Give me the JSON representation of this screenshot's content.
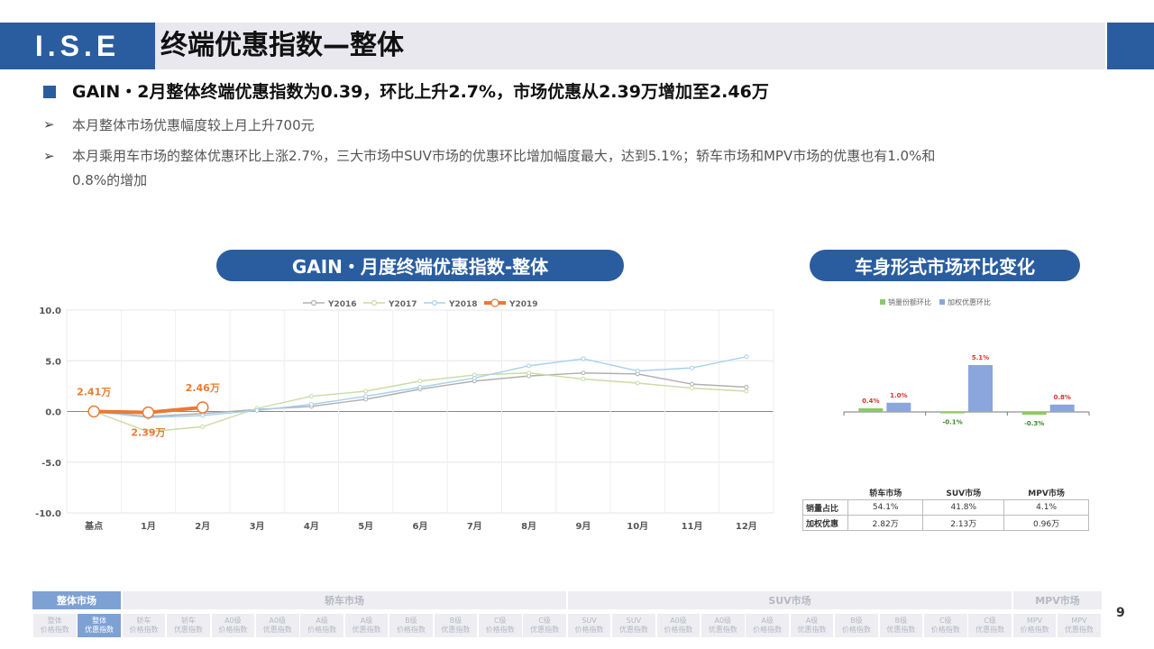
{
  "header": {
    "logo": "I.S.E",
    "title": "终端优惠指数—整体"
  },
  "headline": "GAIN・2月整体终端优惠指数为0.39，环比上升2.7%，市场优惠从2.39万增加至2.46万",
  "bullets": [
    {
      "arrow": "➢",
      "text": "本月整体市场优惠幅度较上月上升700元"
    },
    {
      "arrow": "➢",
      "text": "本月乘用车市场的整体优惠环比上涨2.7%，三大市场中SUV市场的优惠环比增加幅度最大，达到5.1%；轿车市场和MPV市场的优惠也有1.0%和",
      "cont": "0.8%的增加"
    }
  ],
  "left_section_title": "GAIN・月度终端优惠指数-整体",
  "right_section_title": "车身形式市场环比变化",
  "colors": {
    "brand": "#2a5d9f",
    "y2016": "#b0b0b0",
    "y2017": "#c8dca6",
    "y2018": "#a8d0ec",
    "y2019": "#ea7a34",
    "bar_green": "#8dc868",
    "bar_blue": "#8aa6dc"
  },
  "chart_data": [
    {
      "type": "line",
      "categories": [
        "基点",
        "1月",
        "2月",
        "3月",
        "4月",
        "5月",
        "6月",
        "7月",
        "8月",
        "9月",
        "10月",
        "11月",
        "12月"
      ],
      "ylim": [
        -10,
        10
      ],
      "yticks": [
        "10.0",
        "5.0",
        "0.0",
        "-5.0",
        "-10.0"
      ],
      "yticks_values": [
        10,
        5,
        0,
        -5,
        -10
      ],
      "grid": true,
      "legend": "top-center",
      "series": [
        {
          "name": "Y2016",
          "values": [
            0,
            -0.5,
            -0.2,
            0.2,
            0.5,
            1.2,
            2.2,
            3.0,
            3.5,
            3.8,
            3.7,
            2.7,
            2.4
          ]
        },
        {
          "name": "Y2017",
          "values": [
            0,
            -2.0,
            -1.5,
            0.3,
            1.5,
            2.0,
            3.0,
            3.6,
            3.8,
            3.2,
            2.8,
            2.3,
            2.0
          ]
        },
        {
          "name": "Y2018",
          "values": [
            0,
            -0.6,
            -0.4,
            0.1,
            0.7,
            1.5,
            2.4,
            3.3,
            4.5,
            5.2,
            4.0,
            4.3,
            5.4
          ]
        },
        {
          "name": "Y2019",
          "values": [
            0,
            -0.1,
            0.4
          ]
        }
      ],
      "annotations": [
        {
          "text": "2.41万",
          "index": 0,
          "value": 0
        },
        {
          "text": "2.39万",
          "index": 1,
          "value": -0.1
        },
        {
          "text": "2.46万",
          "index": 2,
          "value": 0.4
        }
      ]
    },
    {
      "type": "bar",
      "categories": [
        "轿车市场",
        "SUV市场",
        "MPV市场"
      ],
      "legend": "top-center",
      "series": [
        {
          "name": "销量份额环比",
          "values": [
            0.4,
            -0.1,
            -0.3
          ],
          "labels": [
            "0.4%",
            "-0.1%",
            "-0.3%"
          ]
        },
        {
          "name": "加权优惠环比",
          "values": [
            1.0,
            5.1,
            0.8
          ],
          "labels": [
            "1.0%",
            "5.1%",
            "0.8%"
          ]
        }
      ]
    }
  ],
  "table": {
    "headers": [
      "",
      "轿车市场",
      "SUV市场",
      "MPV市场"
    ],
    "rows": [
      {
        "label": "销量占比",
        "cells": [
          "54.1%",
          "41.8%",
          "4.1%"
        ]
      },
      {
        "label": "加权优惠",
        "cells": [
          "2.82万",
          "2.13万",
          "0.96万"
        ]
      }
    ]
  },
  "footer_nav": {
    "groups": [
      "整体市场",
      "轿车市场",
      "SUV市场",
      "MPV市场"
    ],
    "items": [
      [
        "整体",
        "价格指数"
      ],
      [
        "整体",
        "优惠指数"
      ],
      [
        "轿车",
        "价格指数"
      ],
      [
        "轿车",
        "优惠指数"
      ],
      [
        "A0级",
        "价格指数"
      ],
      [
        "A0级",
        "优惠指数"
      ],
      [
        "A级",
        "价格指数"
      ],
      [
        "A级",
        "优惠指数"
      ],
      [
        "B级",
        "价格指数"
      ],
      [
        "B级",
        "优惠指数"
      ],
      [
        "C级",
        "价格指数"
      ],
      [
        "C级",
        "优惠指数"
      ],
      [
        "SUV",
        "价格指数"
      ],
      [
        "SUV",
        "优惠指数"
      ],
      [
        "A0级",
        "价格指数"
      ],
      [
        "A0级",
        "优惠指数"
      ],
      [
        "A级",
        "价格指数"
      ],
      [
        "A级",
        "优惠指数"
      ],
      [
        "B级",
        "价格指数"
      ],
      [
        "B级",
        "优惠指数"
      ],
      [
        "C级",
        "价格指数"
      ],
      [
        "C级",
        "优惠指数"
      ],
      [
        "MPV",
        "价格指数"
      ],
      [
        "MPV",
        "优惠指数"
      ]
    ],
    "active_index": 1
  },
  "page_number": "9"
}
